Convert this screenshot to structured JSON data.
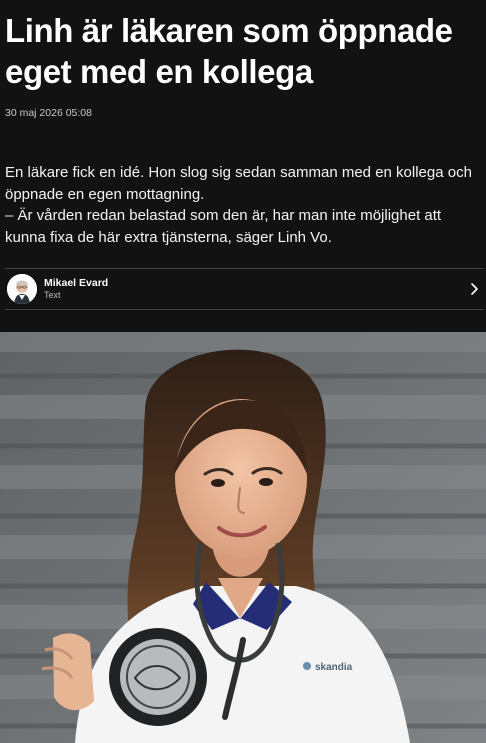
{
  "article": {
    "headline": "Linh är läkaren som öppnade eget med en kollega",
    "timestamp": "30 maj 2026 05:08",
    "lead": [
      "En läkare fick en idé. Hon slog sig sedan samman med en kollega och öppnade en egen mottagning.",
      "– Är vården redan belastad som den är, har man inte möjlighet att kunna fixa de här extra tjänsterna, säger Linh Vo."
    ],
    "author": {
      "name": "Mikael Evard",
      "role": "Text"
    },
    "photo": {
      "shirt_logo": "skandia"
    }
  },
  "colors": {
    "background": "#121212",
    "text": "#ffffff",
    "divider": "#3f3f3f"
  },
  "icons": {
    "chevron": "chevron-right-icon",
    "avatar": "author-avatar"
  }
}
